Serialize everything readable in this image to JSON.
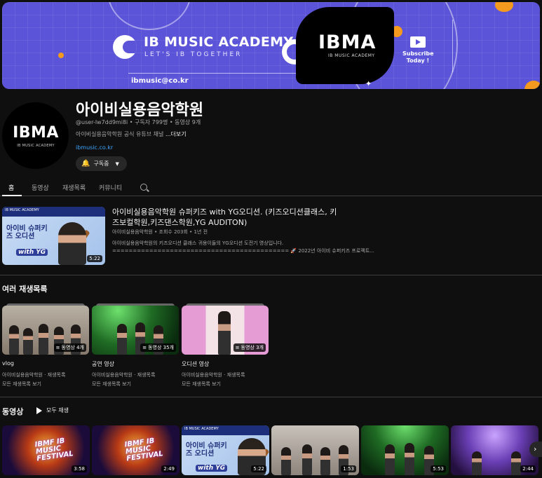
{
  "banner": {
    "title": "IB MUSIC ACADEMY",
    "tagline": "LET'S IB TOGETHER",
    "email": "ibmusic@co.kr",
    "badge_text": "IBMA",
    "badge_sub": "IB MUSIC ACADEMY",
    "subscribe_text": "Subscribe Today !",
    "colors": {
      "background": "#5b54d8",
      "accent": "#f39a1f"
    }
  },
  "channel": {
    "avatar_text": "IBMA",
    "avatar_sub": "IB MUSIC ACADEMY",
    "name": "아이비실용음악학원",
    "meta": "@user-lw7dd9mi8i • 구독자 799명 • 동영상 9개",
    "description": "아이비실용음악학원 공식 유튜브 채널 ",
    "more": "...더보기",
    "link": "ibmusic.co.kr",
    "subscribed_label": "구독중"
  },
  "tabs": [
    {
      "label": "홈",
      "active": true
    },
    {
      "label": "동영상"
    },
    {
      "label": "재생목록"
    },
    {
      "label": "커뮤니티"
    }
  ],
  "featured": {
    "thumb_strip": "IB MUSIC ACADEMY",
    "thumb_text": "아이비 슈퍼키즈 오디션",
    "thumb_yg": "with YG",
    "duration": "5:22",
    "title": "아이비실용음악학원 슈퍼키즈 with YG오디션. (키즈오디션클래스, 키즈보컬학원,키즈댄스학원,YG AUDITON)",
    "meta": "아이비실용음악학원 • 조회수 203회 • 1년 전",
    "desc_line1": "아이비실용음악학원의 키즈오디션 클래스 귀용이들의 YG오디션 도전기 영상입니다.",
    "desc_line2": "=========================================== 🚀 2022년 아이비 슈퍼키즈 프로젝트..."
  },
  "playlists_section": {
    "title": "여러 재생목록",
    "items": [
      {
        "title": "vlog",
        "count": "동영상 4개",
        "owner": "아이비실용음악학원 · 재생목록",
        "link": "모든 재생목록 보기"
      },
      {
        "title": "공연 영상",
        "count": "동영상 35개",
        "owner": "아이비실용음악학원 · 재생목록",
        "link": "모든 재생목록 보기"
      },
      {
        "title": "오디션 영상",
        "count": "동영상 3개",
        "owner": "아이비실용음악학원 · 재생목록",
        "link": "모든 재생목록 보기"
      }
    ]
  },
  "videos_section": {
    "title": "동영상",
    "play_all": "모두 재생",
    "fest_text": "IBMF IB MUSIC FESTIVAL",
    "durations": [
      "3:58",
      "2:49",
      "5:22",
      "1:53",
      "5:53",
      "2:44"
    ]
  }
}
